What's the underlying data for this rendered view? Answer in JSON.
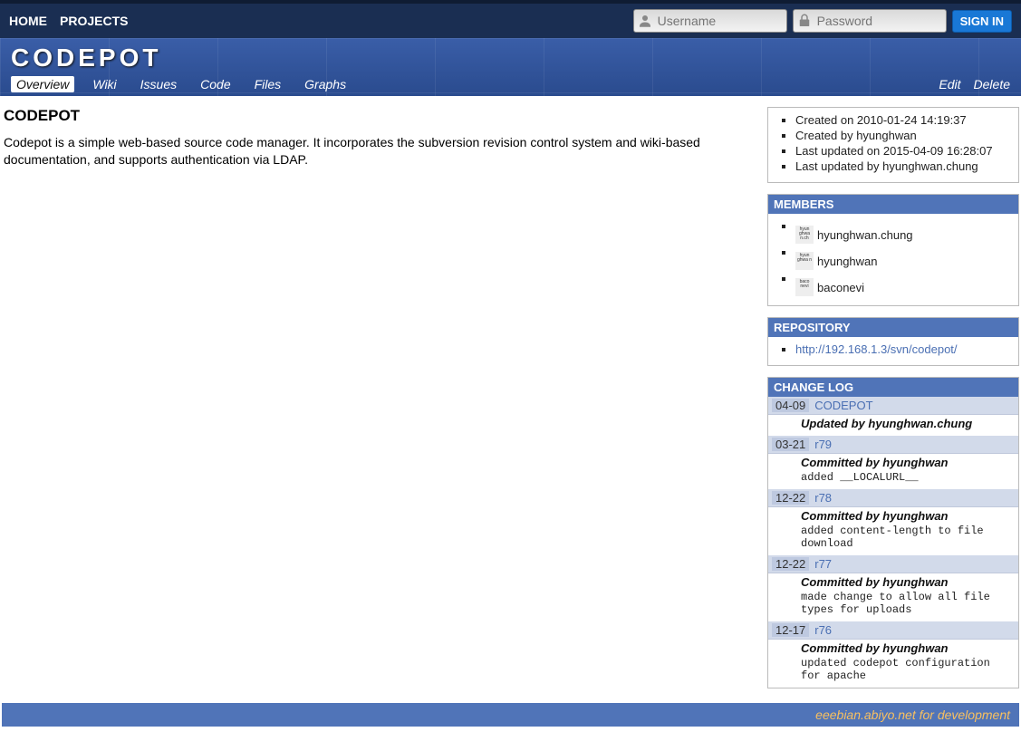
{
  "topnav": {
    "home": "HOME",
    "projects": "PROJECTS"
  },
  "auth": {
    "username_placeholder": "Username",
    "password_placeholder": "Password",
    "signin": "SIGN IN"
  },
  "banner": {
    "title": "CODEPOT"
  },
  "tabs": {
    "overview": "Overview",
    "wiki": "Wiki",
    "issues": "Issues",
    "code": "Code",
    "files": "Files",
    "graphs": "Graphs"
  },
  "actions": {
    "edit": "Edit",
    "delete": "Delete"
  },
  "main": {
    "title": "CODEPOT",
    "description": "Codepot is a simple web-based source code manager. It incorporates the subversion revision control system and wiki-based documentation, and supports authentication via LDAP."
  },
  "meta": {
    "created_on": "Created on 2010-01-24 14:19:37",
    "created_by": "Created by hyunghwan",
    "updated_on": "Last updated on 2015-04-09 16:28:07",
    "updated_by": "Last updated by hyunghwan.chung"
  },
  "members": {
    "header": "MEMBERS",
    "items": [
      {
        "avatar": "hyun ghwa n.ch",
        "name": "hyunghwan.chung"
      },
      {
        "avatar": "hyun ghwa n",
        "name": "hyunghwan"
      },
      {
        "avatar": "baco nevi",
        "name": "baconevi"
      }
    ]
  },
  "repository": {
    "header": "REPOSITORY",
    "url": "http://192.168.1.3/svn/codepot/"
  },
  "changelog": {
    "header": "CHANGE LOG",
    "entries": [
      {
        "date": "04-09",
        "link": "CODEPOT",
        "by": "Updated by hyunghwan.chung",
        "msg": ""
      },
      {
        "date": "03-21",
        "link": "r79",
        "by": "Committed by hyunghwan",
        "msg": "added __LOCALURL__"
      },
      {
        "date": "12-22",
        "link": "r78",
        "by": "Committed by hyunghwan",
        "msg": "added content-length to file download"
      },
      {
        "date": "12-22",
        "link": "r77",
        "by": "Committed by hyunghwan",
        "msg": "made change to allow all file types for uploads"
      },
      {
        "date": "12-17",
        "link": "r76",
        "by": "Committed by hyunghwan",
        "msg": "updated codepot configuration for apache"
      }
    ]
  },
  "footer": "eeebian.abiyo.net for development"
}
